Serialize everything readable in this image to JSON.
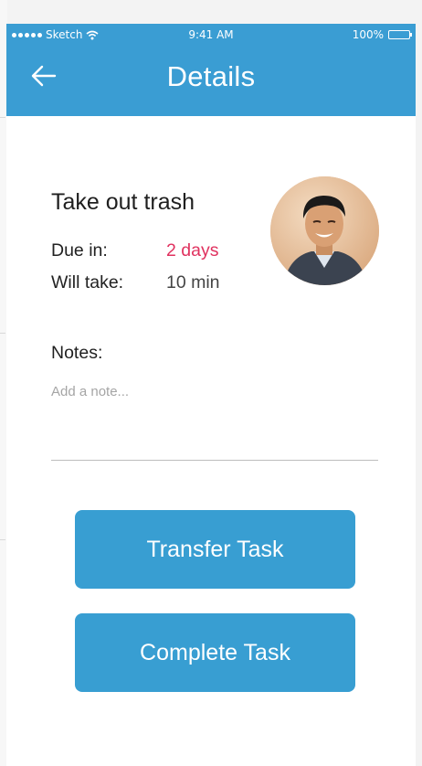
{
  "status_bar": {
    "carrier": "Sketch",
    "time": "9:41 AM",
    "battery": "100%"
  },
  "nav": {
    "title": "Details",
    "back_icon": "arrow-left-icon"
  },
  "task": {
    "title": "Take out trash",
    "due_label": "Due in:",
    "due_value": "2 days",
    "duration_label": "Will take:",
    "duration_value": "10 min"
  },
  "notes": {
    "label": "Notes:",
    "placeholder": "Add a note..."
  },
  "actions": {
    "transfer_label": "Transfer Task",
    "complete_label": "Complete Task"
  },
  "colors": {
    "brand_blue": "#3a9dd3",
    "button_blue": "#389ed2",
    "due_red": "#e0325f"
  }
}
